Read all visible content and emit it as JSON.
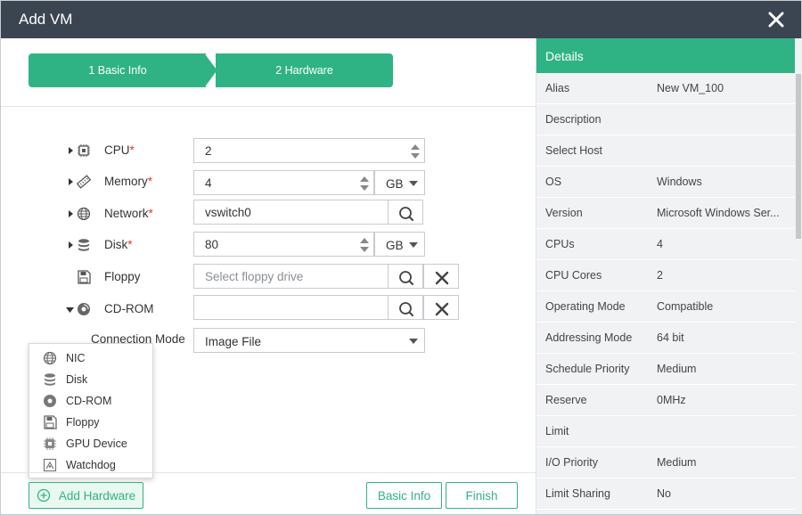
{
  "window": {
    "title": "Add VM"
  },
  "steps": [
    {
      "label": "1 Basic Info"
    },
    {
      "label": "2 Hardware"
    }
  ],
  "form": {
    "cpu": {
      "label": "CPU",
      "required": "*",
      "value": "2"
    },
    "memory": {
      "label": "Memory",
      "required": "*",
      "value": "4",
      "unit": "GB"
    },
    "network": {
      "label": "Network",
      "required": "*",
      "value": "vswitch0"
    },
    "disk": {
      "label": "Disk",
      "required": "*",
      "value": "80",
      "unit": "GB"
    },
    "floppy": {
      "label": "Floppy",
      "placeholder": "Select floppy drive"
    },
    "cdrom": {
      "label": "CD-ROM",
      "value": ""
    },
    "connection_mode": {
      "label": "Connection Mode",
      "value": "Image File"
    }
  },
  "add_menu": {
    "items": [
      {
        "label": "NIC",
        "icon": "globe-icon"
      },
      {
        "label": "Disk",
        "icon": "database-icon"
      },
      {
        "label": "CD-ROM",
        "icon": "disc-icon"
      },
      {
        "label": "Floppy",
        "icon": "floppy-icon"
      },
      {
        "label": "GPU Device",
        "icon": "chip-icon"
      },
      {
        "label": "Watchdog",
        "icon": "watchdog-icon"
      }
    ]
  },
  "footer": {
    "add_hardware": "Add Hardware",
    "basic_info": "Basic Info",
    "finish": "Finish"
  },
  "details": {
    "title": "Details",
    "rows": [
      {
        "key": "Alias",
        "value": "New VM_100"
      },
      {
        "key": "Description",
        "value": ""
      },
      {
        "key": "Select Host",
        "value": ""
      },
      {
        "key": "OS",
        "value": "Windows"
      },
      {
        "key": "Version",
        "value": "Microsoft Windows Ser..."
      },
      {
        "key": "CPUs",
        "value": "4"
      },
      {
        "key": "CPU Cores",
        "value": "2"
      },
      {
        "key": "Operating Mode",
        "value": "Compatible"
      },
      {
        "key": "Addressing Mode",
        "value": "64 bit"
      },
      {
        "key": "Schedule Priority",
        "value": "Medium"
      },
      {
        "key": "Reserve",
        "value": "0MHz"
      },
      {
        "key": "Limit",
        "value": ""
      },
      {
        "key": "I/O Priority",
        "value": "Medium"
      },
      {
        "key": "Limit Sharing",
        "value": "No"
      }
    ]
  },
  "colors": {
    "accent": "#30b384",
    "titlebar": "#3b4552",
    "required": "#e2362f"
  }
}
